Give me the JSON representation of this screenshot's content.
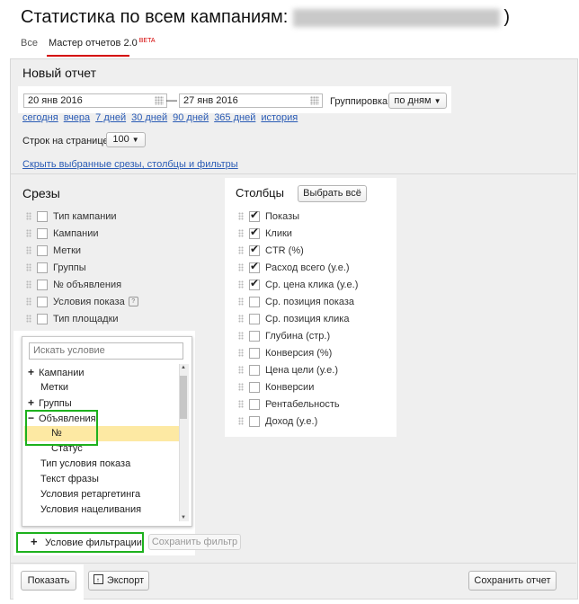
{
  "header": {
    "title_prefix": "Статистика по всем кампаниям:",
    "title_suffix": ")"
  },
  "tabs": [
    {
      "label": "Все"
    },
    {
      "label": "Мастер отчетов 2.0"
    }
  ],
  "tab_badge": "BETA",
  "report": {
    "heading": "Новый отчет",
    "date_from": "20 янв 2016",
    "date_separator": "—",
    "date_to": "27 янв 2016",
    "grouping_label": "Группировка",
    "grouping_value": "по дням",
    "quick_periods": [
      "сегодня",
      "вчера",
      "7 дней",
      "30 дней",
      "90 дней",
      "365 дней",
      "история"
    ],
    "rows_per_page_label": "Строк на странице",
    "rows_per_page_value": "100",
    "hide_link": "Скрыть выбранные срезы, столбцы и фильтры"
  },
  "slices": {
    "heading": "Срезы",
    "items": [
      "Тип кампании",
      "Кампании",
      "Метки",
      "Группы",
      "№ объявления",
      "Условия показа",
      "Тип площадки"
    ],
    "help_badge": "?"
  },
  "columns": {
    "heading": "Столбцы",
    "select_all": "Выбрать всё",
    "items": [
      {
        "label": "Показы",
        "checked": true
      },
      {
        "label": "Клики",
        "checked": true
      },
      {
        "label": "CTR (%)",
        "checked": true
      },
      {
        "label": "Расход всего (у.е.)",
        "checked": true
      },
      {
        "label": "Ср. цена клика (у.е.)",
        "checked": true
      },
      {
        "label": "Ср. позиция показа",
        "checked": false
      },
      {
        "label": "Ср. позиция клика",
        "checked": false
      },
      {
        "label": "Глубина (стр.)",
        "checked": false
      },
      {
        "label": "Конверсия (%)",
        "checked": false
      },
      {
        "label": "Цена цели (у.е.)",
        "checked": false
      },
      {
        "label": "Конверсии",
        "checked": false
      },
      {
        "label": "Рентабельность",
        "checked": false
      },
      {
        "label": "Доход (у.е.)",
        "checked": false
      }
    ]
  },
  "condition_dropdown": {
    "search_placeholder": "Искать условие",
    "items": [
      {
        "label": "Кампании",
        "expander": "+"
      },
      {
        "label": "Метки",
        "expander": ""
      },
      {
        "label": "Группы",
        "expander": "+"
      },
      {
        "label": "Объявления",
        "expander": "−"
      },
      {
        "label": "№",
        "expander": ""
      },
      {
        "label": "Статус",
        "expander": ""
      },
      {
        "label": "Тип условия показа",
        "expander": ""
      },
      {
        "label": "Текст фразы",
        "expander": ""
      },
      {
        "label": "Условия ретаргетинга",
        "expander": ""
      },
      {
        "label": "Условия нацеливания",
        "expander": ""
      }
    ]
  },
  "footer": {
    "add_filter": "Условие фильтрации",
    "add_filter_plus": "+",
    "save_filter": "Сохранить фильтр",
    "show": "Показать",
    "export": "Экспорт",
    "save_report": "Сохранить отчет"
  },
  "colors": {
    "accent_red": "#d40000",
    "highlight_green": "#1db11d",
    "link_blue": "#2a5bb5",
    "selected_row": "#fde9a3"
  }
}
